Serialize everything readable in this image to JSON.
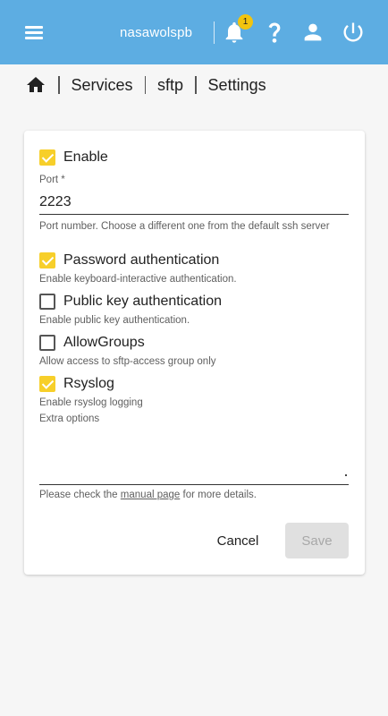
{
  "topbar": {
    "hostname": "nasawolspb",
    "notification_count": "1",
    "icons": [
      "menu-icon",
      "bell-icon",
      "help-icon",
      "user-icon",
      "power-icon"
    ]
  },
  "breadcrumb": {
    "home_icon": "home-icon",
    "items": [
      "Services",
      "sftp",
      "Settings"
    ]
  },
  "form": {
    "enable": {
      "label": "Enable",
      "checked": true
    },
    "port": {
      "label": "Port *",
      "value": "2223",
      "hint": "Port number. Choose a different one from the default ssh server"
    },
    "password_auth": {
      "label": "Password authentication",
      "checked": true,
      "hint": "Enable keyboard-interactive authentication."
    },
    "pubkey_auth": {
      "label": "Public key authentication",
      "checked": false,
      "hint": "Enable public key authentication."
    },
    "allow_groups": {
      "label": "AllowGroups",
      "checked": false,
      "hint": "Allow access to sftp-access group only"
    },
    "rsyslog": {
      "label": "Rsyslog",
      "checked": true,
      "hint": "Enable rsyslog logging"
    },
    "extra_options": {
      "label": "Extra options",
      "value": ""
    },
    "manual_hint": {
      "before": "Please check the",
      "link": "manual page",
      "after": "for more details."
    }
  },
  "actions": {
    "cancel_label": "Cancel",
    "save_label": "Save"
  },
  "colors": {
    "topbar": "#5dade2",
    "checkbox": "#f7cf2a",
    "badge": "#f1c40f"
  }
}
